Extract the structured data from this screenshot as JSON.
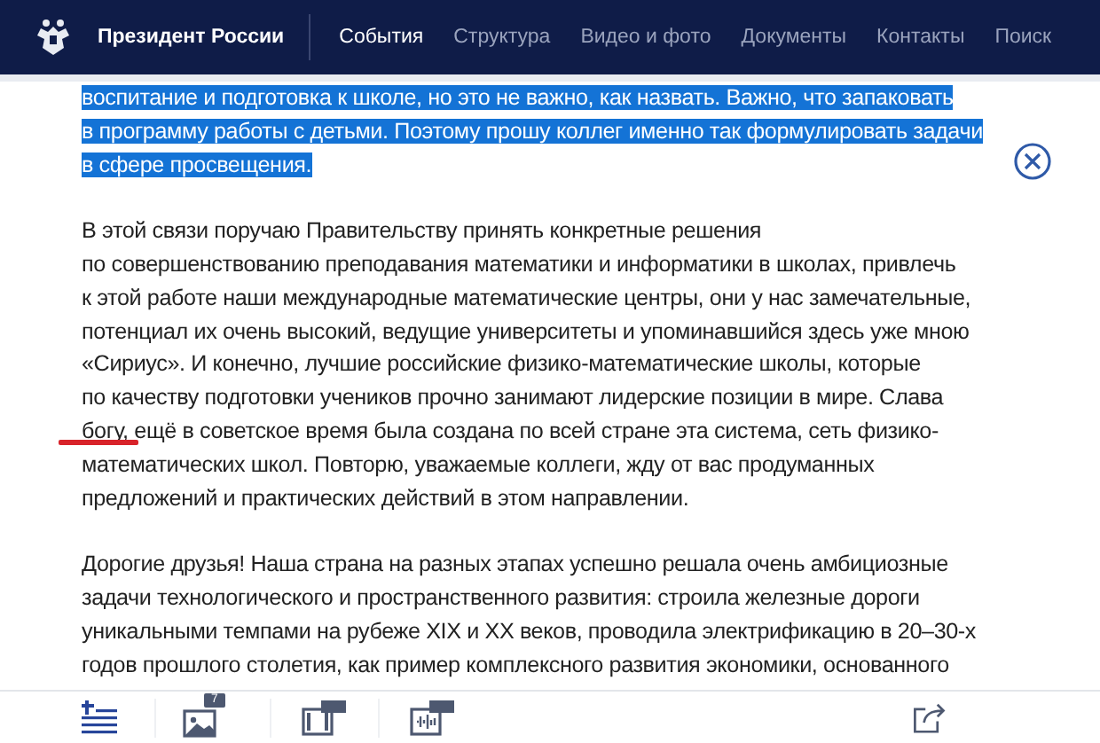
{
  "header": {
    "site_title": "Президент России",
    "nav": [
      {
        "label": "События",
        "selected": true
      },
      {
        "label": "Структура",
        "selected": false
      },
      {
        "label": "Видео и фото",
        "selected": false
      },
      {
        "label": "Документы",
        "selected": false
      },
      {
        "label": "Контакты",
        "selected": false
      },
      {
        "label": "Поиск",
        "selected": false
      }
    ]
  },
  "article": {
    "paragraphs": [
      {
        "selected": true,
        "lines": [
          "воспитание и подготовка к школе, но это не важно, как назвать. Важно, что запаковать",
          "в программу работы с детьми. Поэтому прошу коллег именно так формулировать задачи",
          "в сфере просвещения."
        ]
      },
      {
        "selected": false,
        "lines": [
          "В этой связи поручаю Правительству принять конкретные решения",
          "по совершенствованию преподавания математики и информатики в школах, привлечь",
          "к этой работе наши международные математические центры, они у нас замечательные,",
          "потенциал их очень высокий, ведущие университеты и упоминавшийся здесь уже мною",
          "«Сириус». И конечно, лучшие российские физико-математические школы, которые",
          "по качеству подготовки учеников прочно занимают лидерские позиции в мире. Слава",
          "богу, ещё в советское время была создана по всей стране эта система, сеть физико-",
          "математических школ. Повторю, уважаемые коллеги, жду от вас продуманных",
          "предложений и практических действий в этом направлении."
        ]
      },
      {
        "selected": false,
        "lines": [
          "Дорогие друзья! Наша страна на разных этапах успешно решала очень амбициозные",
          "задачи технологического и пространственного развития: строила железные дороги",
          "уникальными темпами на рубеже XIX и XX веков, проводила электрификацию в 20–30-х",
          "годов прошлого столетия, как пример комплексного развития экономики, основанного"
        ]
      }
    ]
  },
  "toolbar": {
    "photo_count": "7"
  }
}
